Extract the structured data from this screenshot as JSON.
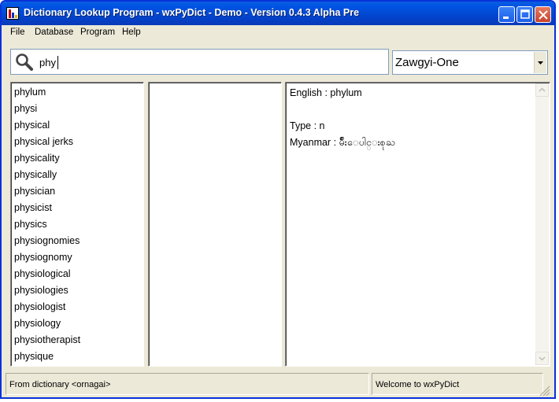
{
  "window": {
    "title": "Dictionary Lookup Program - wxPyDict - Demo - Version 0.4.3 Alpha Pre"
  },
  "menu": [
    "File",
    "Database",
    "Program",
    "Help"
  ],
  "search": {
    "value": "phy",
    "font": "Zawgyi-One"
  },
  "word_list": [
    "phylum",
    "physi",
    "physical",
    "physical jerks",
    "physicality",
    "physically",
    "physician",
    "physicist",
    "physics",
    "physiognomies",
    "physiognomy",
    "physiological",
    "physiologies",
    "physiologist",
    "physiology",
    "physiotherapist",
    "physique"
  ],
  "definition": {
    "english": "English : phylum",
    "type": "Type : n",
    "myanmar": "Myanmar : မ်ိဳးေပါင္းစုႀ"
  },
  "status": {
    "left": "From dictionary <ornagai>",
    "right": "Welcome to wxPyDict"
  },
  "colors": {
    "titlebar": "#0054e3",
    "window_bg": "#ece9d8",
    "close_button": "#c8432a"
  }
}
